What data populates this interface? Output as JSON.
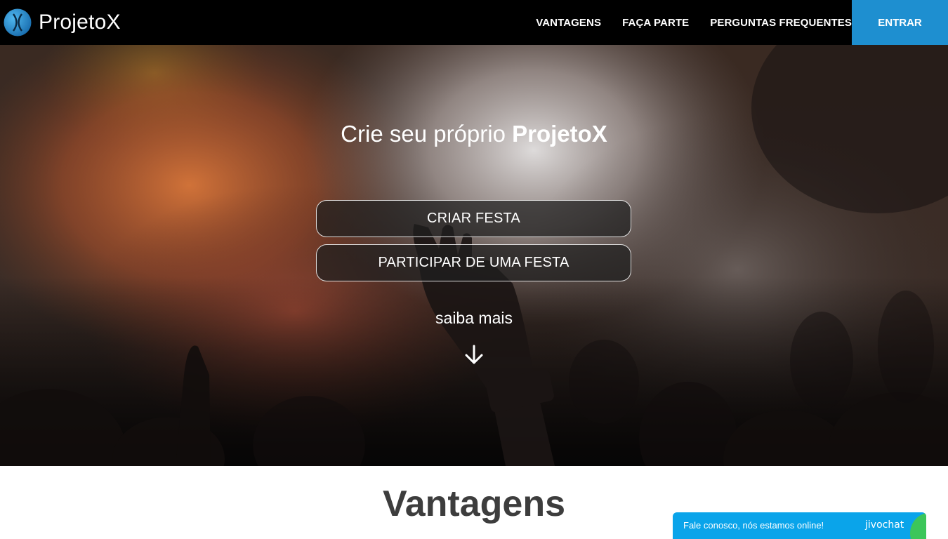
{
  "navbar": {
    "brand": "ProjetoX",
    "logo_icon": "x-logo-icon",
    "links": [
      "VANTAGENS",
      "FAÇA PARTE",
      "PERGUNTAS FREQUENTES"
    ],
    "login_label": "ENTRAR",
    "accent_color": "#1e8fd0"
  },
  "hero": {
    "title_prefix": "Crie seu próprio ",
    "title_strong": "ProjetoX",
    "create_party": "CRIAR FESTA",
    "join_party": "PARTICIPAR DE UMA FESTA",
    "learn_more": "saiba mais",
    "scroll_icon": "arrow-down-icon"
  },
  "section": {
    "title": "Vantagens"
  },
  "chat": {
    "text": "Fale conosco, nós estamos online!",
    "brand": "jivochat",
    "color": "#0aa4ea"
  }
}
